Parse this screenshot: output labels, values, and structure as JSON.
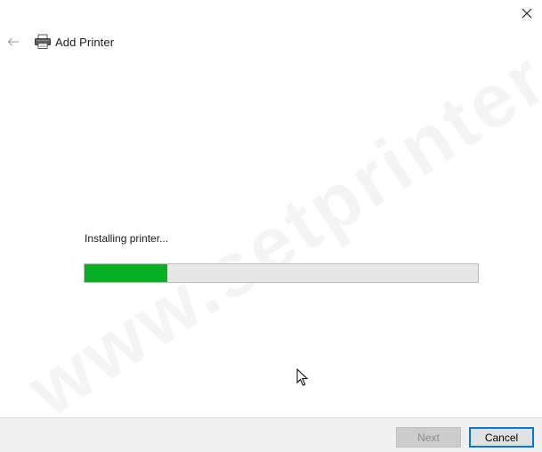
{
  "header": {
    "title": "Add Printer",
    "back_icon": "arrow-left-icon",
    "printer_icon": "printer-icon",
    "close_icon": "close-icon"
  },
  "status": {
    "text": "Installing printer...",
    "progress": 0.21,
    "progress_color": "#06b025"
  },
  "watermark": {
    "text": "www.setprinter.com"
  },
  "footer": {
    "next_label": "Next",
    "cancel_label": "Cancel"
  }
}
